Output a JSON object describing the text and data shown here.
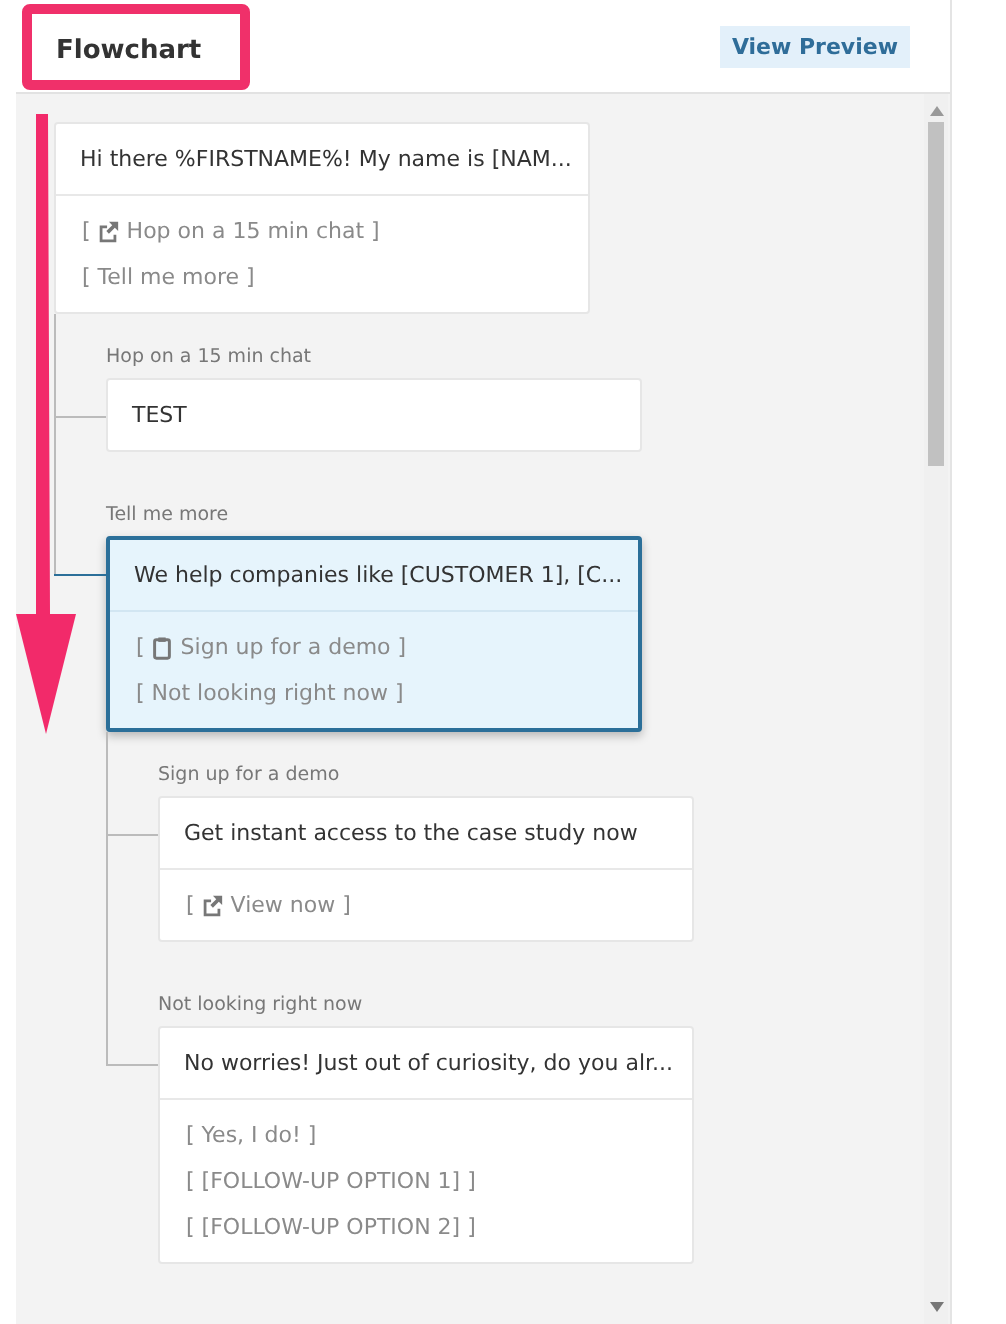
{
  "header": {
    "title": "Flowchart",
    "title_highlighted": true,
    "button": "View Preview"
  },
  "annotation_arrow": true,
  "flow": {
    "message": "Hi there %FIRSTNAME%! My name is [NAM...",
    "selected": false,
    "options": [
      {
        "before": "[",
        "kind": "external",
        "text": "Hop on a 15 min chat ]"
      },
      {
        "text": "[ Tell me more ]"
      }
    ],
    "children": [
      {
        "label": "Hop on a 15 min chat",
        "message": "TEST",
        "selected": false
      },
      {
        "label": "Tell me more",
        "message": "We help companies like [CUSTOMER 1], [C...",
        "selected": true,
        "options": [
          {
            "before": "[",
            "kind": "clipboard",
            "text": "Sign up for a demo ]"
          },
          {
            "text": "[ Not looking right now ]"
          }
        ],
        "children": [
          {
            "label": "Sign up for a demo",
            "message": "Get instant access to the case study now",
            "selected": false,
            "options": [
              {
                "before": "[",
                "kind": "external",
                "text": "View now ]"
              }
            ]
          },
          {
            "label": "Not looking right now",
            "message": "No worries! Just out of curiosity, do you alr...",
            "selected": false,
            "options": [
              {
                "text": "[ Yes, I do! ]"
              },
              {
                "text": "[ [FOLLOW-UP OPTION 1] ]"
              },
              {
                "text": "[ [FOLLOW-UP OPTION 2] ]"
              }
            ]
          }
        ]
      }
    ]
  }
}
